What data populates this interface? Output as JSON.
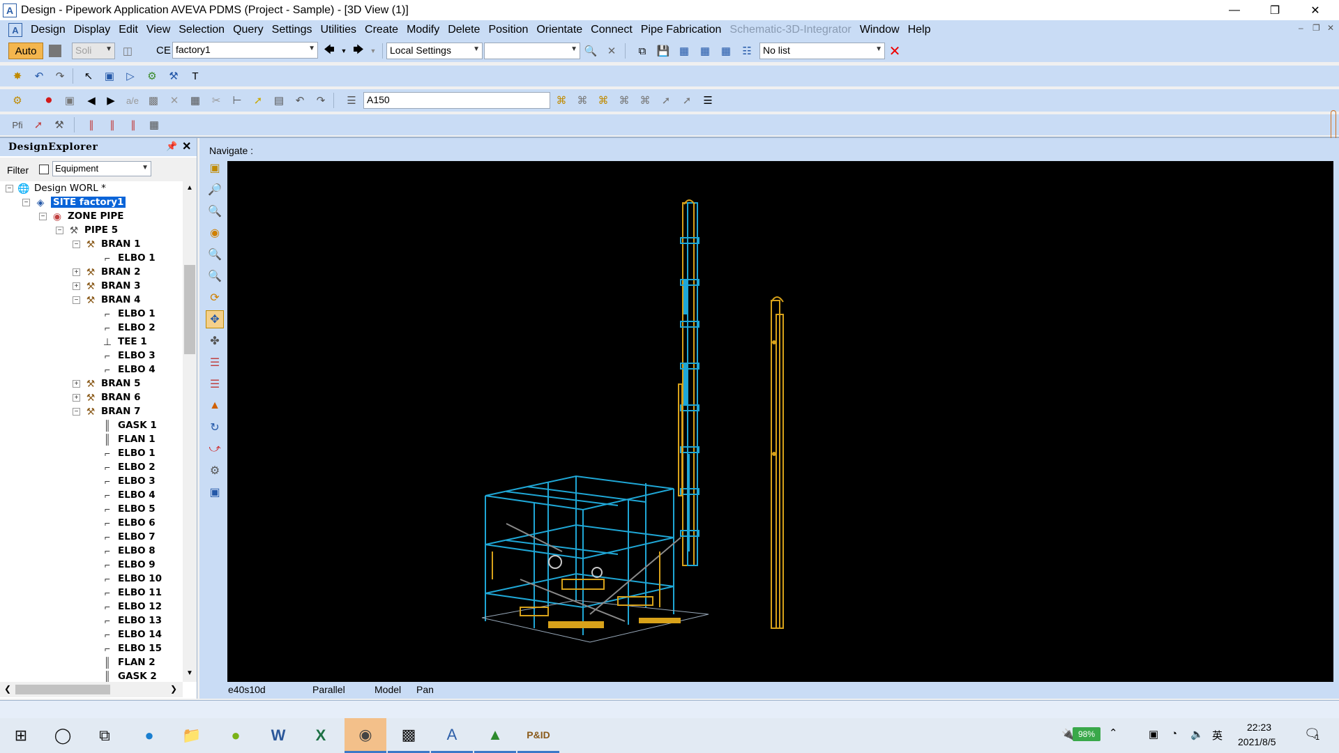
{
  "window": {
    "title": "Design - Pipework Application  AVEVA PDMS (Project - Sample) - [3D View (1)]",
    "app_icon_letter": "A",
    "controls": [
      "minimize",
      "restore",
      "close"
    ]
  },
  "menu": {
    "items": [
      "Design",
      "Display",
      "Edit",
      "View",
      "Selection",
      "Query",
      "Settings",
      "Utilities",
      "Create",
      "Modify",
      "Delete",
      "Position",
      "Orientate",
      "Connect",
      "Pipe Fabrication",
      "Schematic-3D-Integrator",
      "Window",
      "Help"
    ],
    "disabled_item": "Schematic-3D-Integrator"
  },
  "toolbar1": {
    "auto_label": "Auto",
    "solid_combo": "Soli",
    "ce_label": "CE",
    "ce_value": "factory1",
    "local_settings": "Local Settings",
    "empty_combo": "",
    "list_combo": "No list"
  },
  "toolbar3": {
    "spec_value": "A150"
  },
  "explorer": {
    "title": "DesignExplorer",
    "filter_label": "Filter",
    "filter_value": "Equipment",
    "tree": [
      {
        "label": "Design WORL *",
        "level": 0,
        "expander": "minus",
        "icon": "globe",
        "bold": false
      },
      {
        "label": "SITE factory1",
        "level": 1,
        "expander": "minus",
        "icon": "site",
        "selected": true
      },
      {
        "label": "ZONE PIPE",
        "level": 2,
        "expander": "minus",
        "icon": "zone"
      },
      {
        "label": "PIPE 5",
        "level": 3,
        "expander": "minus",
        "icon": "pipe"
      },
      {
        "label": "BRAN 1",
        "level": 4,
        "expander": "minus",
        "icon": "bran"
      },
      {
        "label": "ELBO 1",
        "level": 5,
        "expander": "",
        "icon": "elbo"
      },
      {
        "label": "BRAN 2",
        "level": 4,
        "expander": "plus",
        "icon": "bran"
      },
      {
        "label": "BRAN 3",
        "level": 4,
        "expander": "plus",
        "icon": "bran"
      },
      {
        "label": "BRAN 4",
        "level": 4,
        "expander": "minus",
        "icon": "bran"
      },
      {
        "label": "ELBO 1",
        "level": 5,
        "expander": "",
        "icon": "elbo"
      },
      {
        "label": "ELBO 2",
        "level": 5,
        "expander": "",
        "icon": "elbo"
      },
      {
        "label": "TEE 1",
        "level": 5,
        "expander": "",
        "icon": "tee"
      },
      {
        "label": "ELBO 3",
        "level": 5,
        "expander": "",
        "icon": "elbo"
      },
      {
        "label": "ELBO 4",
        "level": 5,
        "expander": "",
        "icon": "elbo"
      },
      {
        "label": "BRAN 5",
        "level": 4,
        "expander": "plus",
        "icon": "bran"
      },
      {
        "label": "BRAN 6",
        "level": 4,
        "expander": "plus",
        "icon": "bran"
      },
      {
        "label": "BRAN 7",
        "level": 4,
        "expander": "minus",
        "icon": "bran"
      },
      {
        "label": "GASK 1",
        "level": 5,
        "expander": "",
        "icon": "gask"
      },
      {
        "label": "FLAN 1",
        "level": 5,
        "expander": "",
        "icon": "flan"
      },
      {
        "label": "ELBO 1",
        "level": 5,
        "expander": "",
        "icon": "elbo"
      },
      {
        "label": "ELBO 2",
        "level": 5,
        "expander": "",
        "icon": "elbo"
      },
      {
        "label": "ELBO 3",
        "level": 5,
        "expander": "",
        "icon": "elbo"
      },
      {
        "label": "ELBO 4",
        "level": 5,
        "expander": "",
        "icon": "elbo"
      },
      {
        "label": "ELBO 5",
        "level": 5,
        "expander": "",
        "icon": "elbo"
      },
      {
        "label": "ELBO 6",
        "level": 5,
        "expander": "",
        "icon": "elbo"
      },
      {
        "label": "ELBO 7",
        "level": 5,
        "expander": "",
        "icon": "elbo"
      },
      {
        "label": "ELBO 8",
        "level": 5,
        "expander": "",
        "icon": "elbo"
      },
      {
        "label": "ELBO 9",
        "level": 5,
        "expander": "",
        "icon": "elbo"
      },
      {
        "label": "ELBO 10",
        "level": 5,
        "expander": "",
        "icon": "elbo"
      },
      {
        "label": "ELBO 11",
        "level": 5,
        "expander": "",
        "icon": "elbo"
      },
      {
        "label": "ELBO 12",
        "level": 5,
        "expander": "",
        "icon": "elbo"
      },
      {
        "label": "ELBO 13",
        "level": 5,
        "expander": "",
        "icon": "elbo"
      },
      {
        "label": "ELBO 14",
        "level": 5,
        "expander": "",
        "icon": "elbo"
      },
      {
        "label": "ELBO 15",
        "level": 5,
        "expander": "",
        "icon": "elbo"
      },
      {
        "label": "FLAN 2",
        "level": 5,
        "expander": "",
        "icon": "flan"
      },
      {
        "label": "GASK 2",
        "level": 5,
        "expander": "",
        "icon": "gask"
      }
    ]
  },
  "view": {
    "navigate_label": "Navigate :",
    "status": [
      "e40s10d",
      "Parallel",
      "Model",
      "Pan"
    ]
  },
  "taskbar": {
    "battery": "98%",
    "ime": "英",
    "time": "22:23",
    "date": "2021/8/5",
    "notifications": "1"
  },
  "colors": {
    "chrome": "#c9dcf5",
    "selection": "#0a64d8",
    "viewport": "#000000",
    "model_cyan": "#1fa7d6",
    "model_yellow": "#d8a21a"
  }
}
